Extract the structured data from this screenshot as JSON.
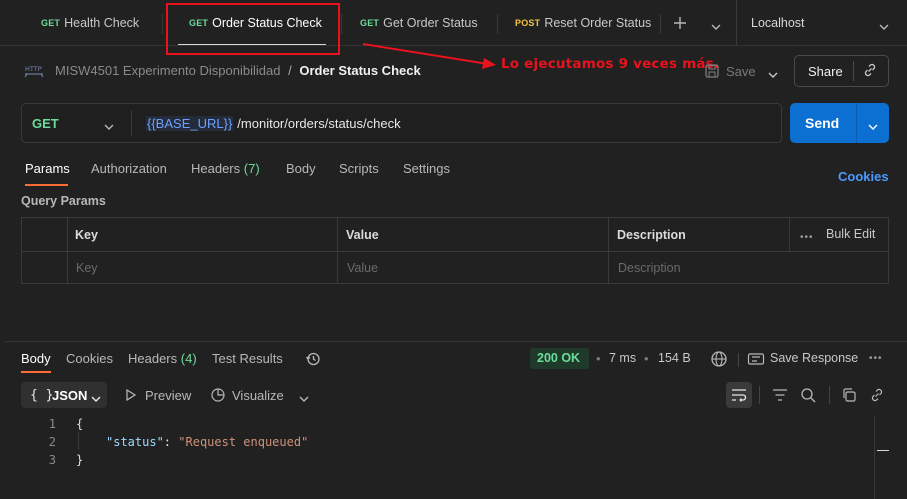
{
  "tabs": [
    {
      "method": "GET",
      "label": "Health Check"
    },
    {
      "method": "GET",
      "label": "Order Status Check"
    },
    {
      "method": "GET",
      "label": "Get Order Status"
    },
    {
      "method": "POST",
      "label": "Reset Order Status"
    }
  ],
  "environment": "Localhost",
  "breadcrumb": {
    "collection": "MISW4501 Experimento Disponibilidad",
    "separator": "/",
    "request": "Order Status Check",
    "http_badge": "HTTP"
  },
  "annotation": "Lo ejecutamos 9 veces más.",
  "toolbar": {
    "save": "Save",
    "share": "Share"
  },
  "request": {
    "method": "GET",
    "base_url": "{{BASE_URL}}",
    "path": "/monitor/orders/status/check",
    "send": "Send"
  },
  "request_tabs": {
    "params": "Params",
    "authorization": "Authorization",
    "headers": "Headers",
    "headers_count": "(7)",
    "body": "Body",
    "scripts": "Scripts",
    "settings": "Settings",
    "cookies": "Cookies"
  },
  "query_params": {
    "title": "Query Params",
    "columns": [
      "Key",
      "Value",
      "Description"
    ],
    "bulk_edit": "Bulk Edit",
    "placeholders": [
      "Key",
      "Value",
      "Description"
    ]
  },
  "response": {
    "tabs": {
      "body": "Body",
      "cookies": "Cookies",
      "headers": "Headers",
      "headers_count": "(4)",
      "test_results": "Test Results"
    },
    "status": "200 OK",
    "time": "7 ms",
    "size": "154 B",
    "save_response": "Save Response",
    "format": "JSON",
    "preview": "Preview",
    "visualize": "Visualize",
    "lines": [
      "1",
      "2",
      "3"
    ],
    "code": {
      "open": "{",
      "key": "\"status\"",
      "colon": ":",
      "value": "\"Request enqueued\"",
      "close": "}"
    }
  },
  "colors": {
    "accent": "#0c6fd2",
    "get": "#6bdd9a",
    "post": "#f5c542",
    "annotation": "#e8131d",
    "status_ok": "#6bdd9a"
  }
}
